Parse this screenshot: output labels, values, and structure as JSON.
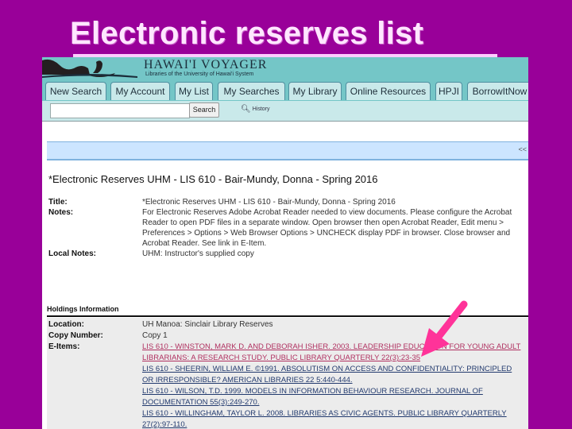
{
  "slide": {
    "title": "Electronic reserves list",
    "background_color": "#990099",
    "accent_color": "#ff3399"
  },
  "header": {
    "brand": "HAWAI'I VOYAGER",
    "subtitle": "Libraries of the University of Hawai'i System"
  },
  "tabs": [
    {
      "label": "New Search"
    },
    {
      "label": "My Account"
    },
    {
      "label": "My List"
    },
    {
      "label": "My Searches"
    },
    {
      "label": "My Library"
    },
    {
      "label": "Online Resources"
    },
    {
      "label": "HPJI"
    },
    {
      "label": "BorrowItNow"
    }
  ],
  "search": {
    "value": "",
    "placeholder": "",
    "button_label": "Search",
    "history_label": "History",
    "history_icon": "history-icon"
  },
  "navstrip": {
    "collapse_label": "<<"
  },
  "record": {
    "heading": "*Electronic Reserves UHM - LIS 610 - Bair-Mundy, Donna - Spring 2016",
    "fields": [
      {
        "label": "Title:",
        "value": "*Electronic Reserves UHM - LIS 610 - Bair-Mundy, Donna - Spring 2016"
      },
      {
        "label": "Notes:",
        "value": "For Electronic Reserves Adobe Acrobat Reader needed to view documents. Please configure the Acrobat Reader to open PDF files in a separate window. Open browser then open Acrobat Reader, Edit menu > Preferences > Options > Web Browser Options > UNCHECK display PDF in browser. Close browser and Acrobat Reader. See link in E-Item."
      },
      {
        "label": "Local Notes:",
        "value": "UHM: Instructor's supplied copy"
      }
    ]
  },
  "holdings": {
    "heading": "Holdings Information",
    "location_label": "Location:",
    "location": "UH Manoa: Sinclair Library Reserves",
    "copy_label": "Copy Number:",
    "copy": "Copy 1",
    "eitems_label": "E-Items:",
    "eitems": [
      {
        "text": "LIS 610 - WINSTON, MARK D. AND DEBORAH ISHER. 2003. LEADERSHIP EDUCATION FOR YOUNG ADULT LIBRARIANS: A RESEARCH STUDY. PUBLIC LIBRARY QUARTERLY 22(3):23-35",
        "visited": true
      },
      {
        "text": "LIS 610 - SHEERIN, WILLIAM E. ©1991. ABSOLUTISM ON ACCESS AND CONFIDENTIALITY: PRINCIPLED OR IRRESPONSIBLE? AMERICAN LIBRARIES 22 5:440-444.",
        "visited": false
      },
      {
        "text": "LIS 610 - WILSON, T.D. 1999. MODELS IN INFORMATION BEHAVIOUR RESEARCH. JOURNAL OF DOCUMENTATION 55(3):249-270.",
        "visited": false
      },
      {
        "text": "LIS 610 - WILLINGHAM, TAYLOR L. 2008. LIBRARIES AS CIVIC AGENTS. PUBLIC LIBRARY QUARTERLY 27(2):97-110.",
        "visited": false
      }
    ]
  },
  "annotation": {
    "icon": "pointer-arrow-icon"
  }
}
